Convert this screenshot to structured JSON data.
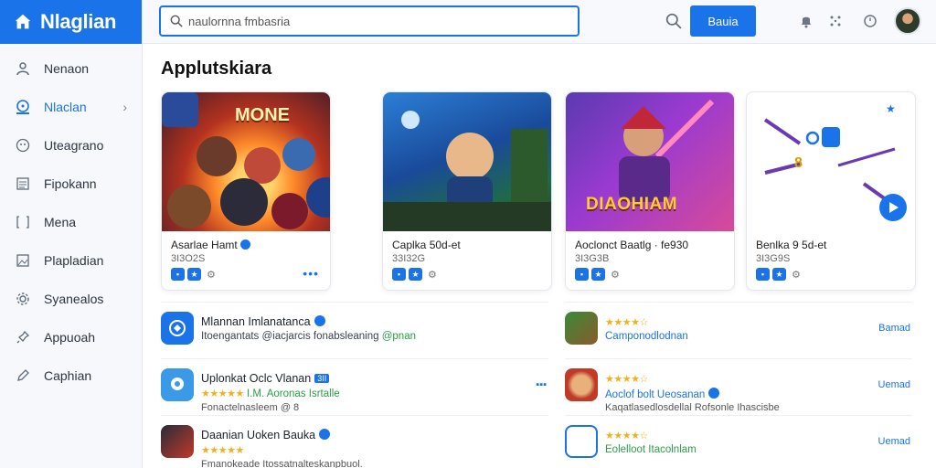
{
  "app": {
    "title": "Nlaglian"
  },
  "sidebar": {
    "items": [
      {
        "label": "Nenaon",
        "icon": "user-icon",
        "active": false
      },
      {
        "label": "Nlaclan",
        "icon": "smile-icon",
        "active": true
      },
      {
        "label": "Uteagrano",
        "icon": "face-icon",
        "active": false
      },
      {
        "label": "Fipokann",
        "icon": "list-icon",
        "active": false
      },
      {
        "label": "Mena",
        "icon": "bracket-icon",
        "active": false
      },
      {
        "label": "Plapladian",
        "icon": "image-icon",
        "active": false
      },
      {
        "label": "Syanealos",
        "icon": "gear-icon",
        "active": false
      },
      {
        "label": "Appuoah",
        "icon": "pin-icon",
        "active": false
      },
      {
        "label": "Caphian",
        "icon": "pencil-icon",
        "active": false
      }
    ]
  },
  "topbar": {
    "search_value": "naulornna fmbasria",
    "primary_button": "Bauia",
    "icons": [
      "search-icon",
      "bell-icon",
      "grid-icon",
      "clock-icon",
      "avatar"
    ]
  },
  "section": {
    "title": "Applutskiara"
  },
  "cards": [
    {
      "name": "Asarlae Hamt",
      "meta": "3I3O2S",
      "art_text": "MONE"
    },
    {
      "name": "Caplka 50d-et",
      "meta": "33I32G",
      "art_text": ""
    },
    {
      "name": "Aoclonct Baatlg · fe930",
      "meta": "3I3G3B",
      "art_text": "DIAOHIAM"
    },
    {
      "name": "Benlka 9 5d-et",
      "meta": "3I3G9S",
      "art_text": ""
    }
  ],
  "list_left": [
    {
      "title": "Mlannan Imlanatanca",
      "line2": "Itoengantats @iacjarcis fonabsleaning",
      "line2_green": "@pnan",
      "line3": ""
    },
    {
      "title": "Uplonkat Oclc Vlanan",
      "tag": "3II",
      "rating": "★★★★★",
      "line2": "I.M. Aoronas Isrtalle",
      "line3": "Fonactelnasleem @ 8"
    },
    {
      "title": "Daanian Uoken Bauka",
      "rating": "★★★★★",
      "line2": "",
      "line3": "Fmanokeade Itossatnalteskanpbuol."
    }
  ],
  "list_right": [
    {
      "rating": "★★★★☆",
      "title": "Camponodlodnan",
      "action": "Bamad"
    },
    {
      "rating": "★★★★☆",
      "title": "Aoclof bolt Ueosanan",
      "line3": "Kaqatlasedlosdellal Rofsonle Ihascisbe",
      "action": "Uemad"
    },
    {
      "rating": "★★★★☆",
      "title": "Eolelloot Itacolnlam",
      "action": "Uemad"
    }
  ],
  "colors": {
    "accent": "#1a73e8",
    "star": "#f2b01e",
    "green": "#2a9d4a"
  }
}
